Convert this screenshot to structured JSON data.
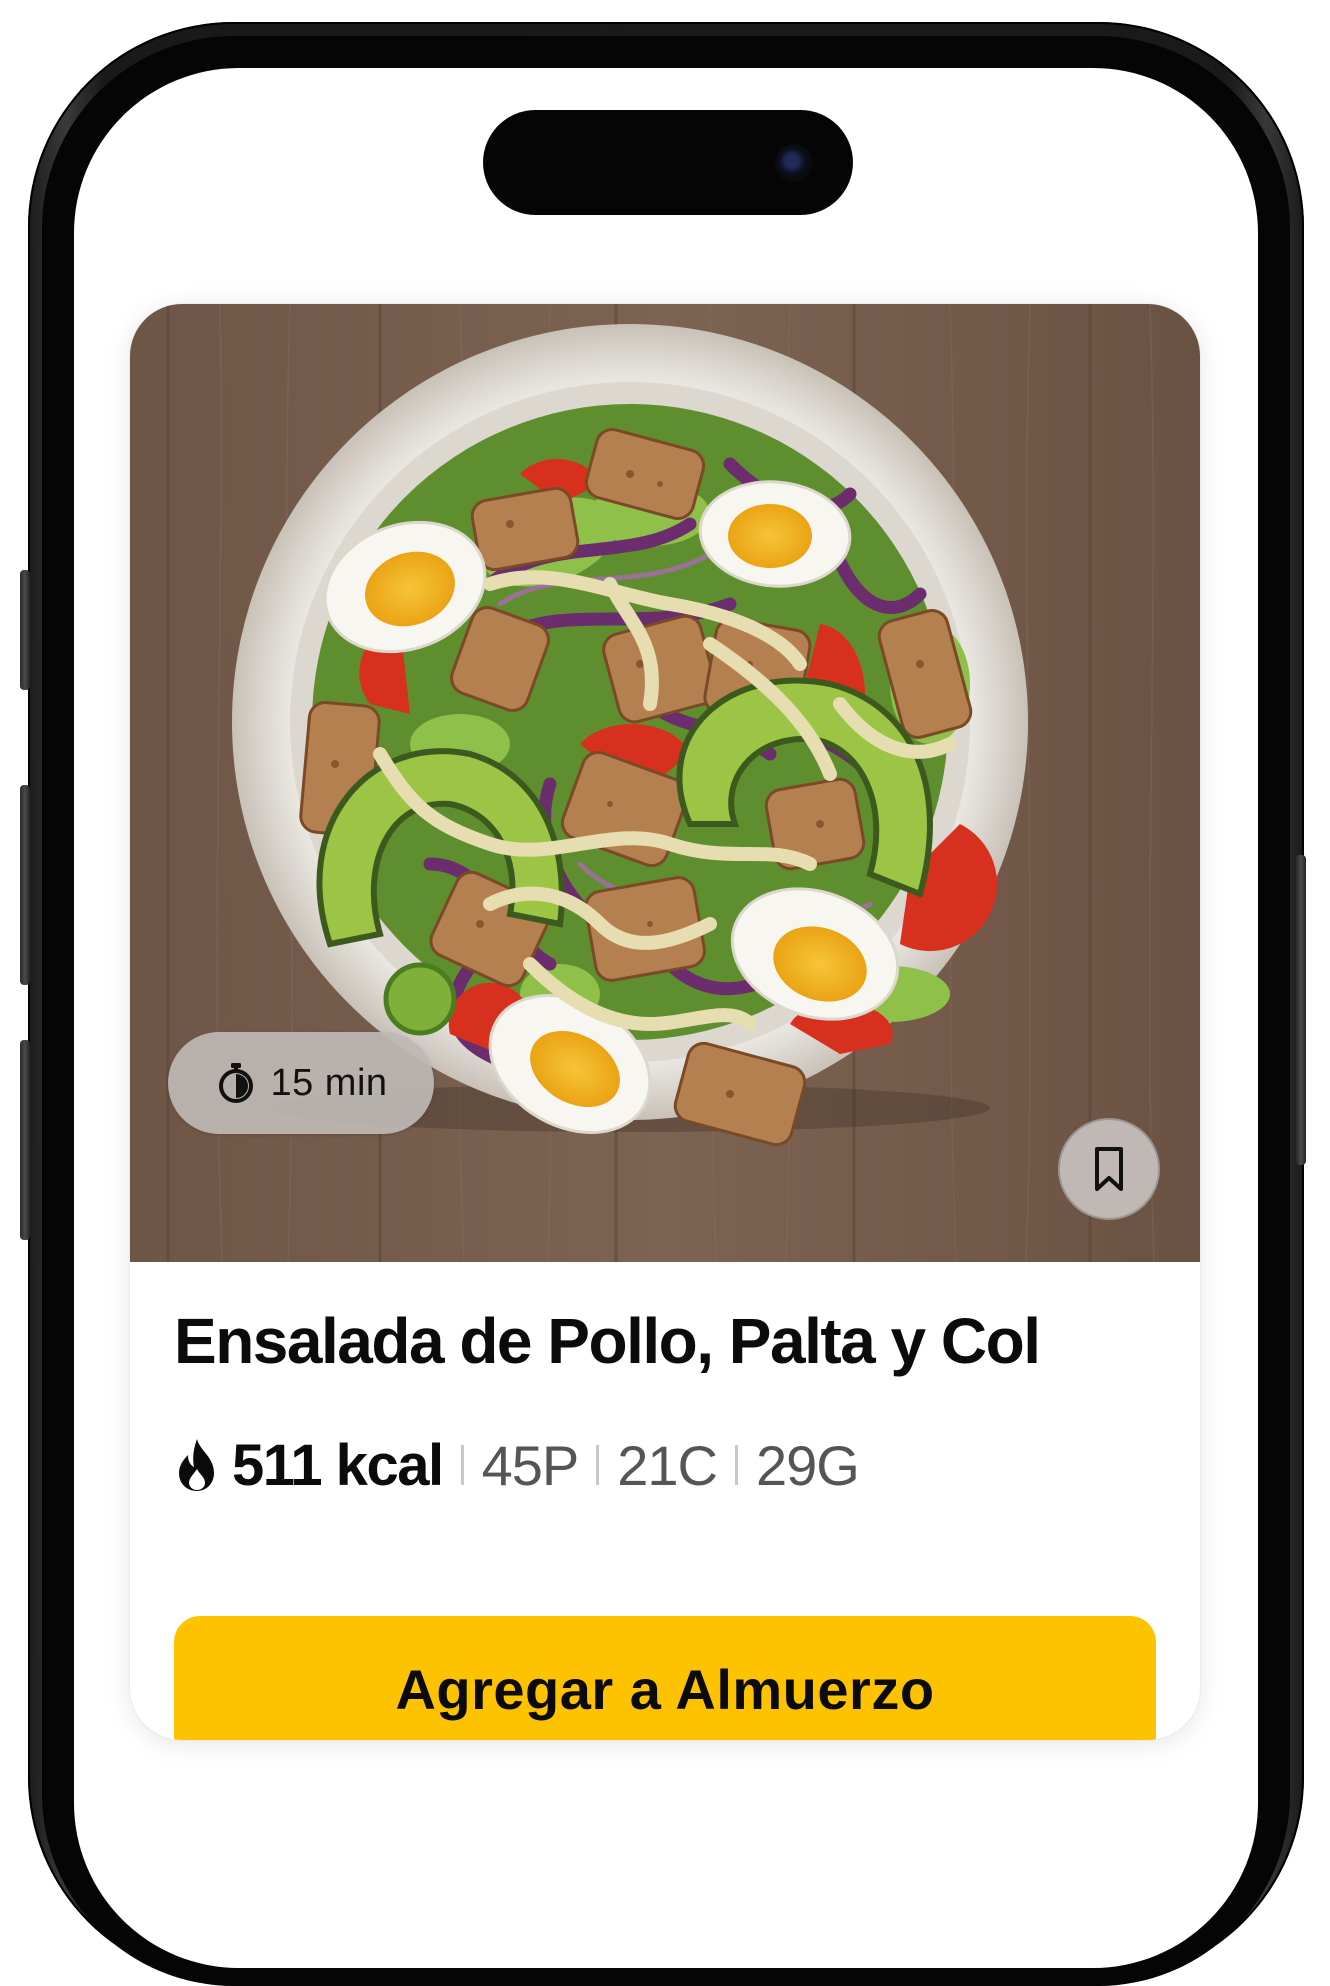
{
  "recipe": {
    "time": "15 min",
    "title": "Ensalada de Pollo, Palta y Col",
    "kcal": "511 kcal",
    "protein": "45P",
    "carbs": "21C",
    "fat": "29G"
  },
  "actions": {
    "add_label": "Agregar a Almuerzo"
  },
  "icons": {
    "time": "stopwatch-icon",
    "bookmark": "bookmark-icon",
    "calories": "flame-icon"
  },
  "colors": {
    "accent": "#fdc300",
    "card_background": "#ffffff",
    "badge_background": "#bfb8b4"
  }
}
